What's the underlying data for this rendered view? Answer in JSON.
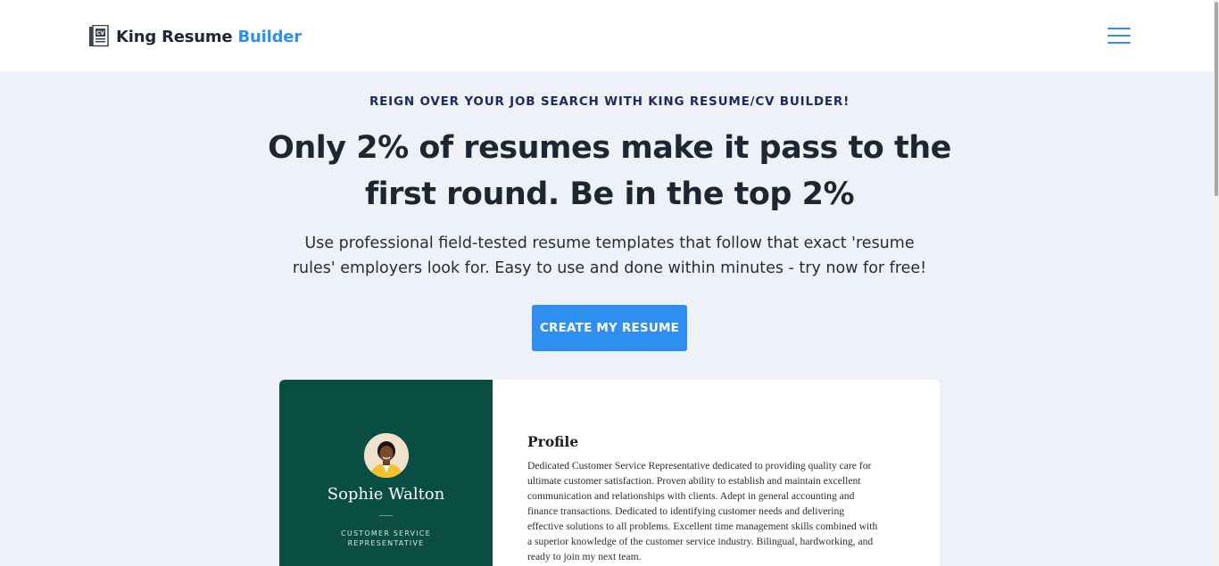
{
  "header": {
    "logo_text": "King Resume",
    "logo_accent": "Builder",
    "logo_icon_label": "CV",
    "menu_icon": "hamburger-menu-icon"
  },
  "hero": {
    "eyebrow": "REIGN OVER YOUR JOB SEARCH WITH KING RESUME/CV BUILDER!",
    "headline_line1": "Only 2% of resumes make it pass to the",
    "headline_line2": "first round. Be in the top 2%",
    "subhead_line1": "Use professional field-tested resume templates that follow that exact 'resume",
    "subhead_line2": "rules' employers look for. Easy to use and done within minutes - try now for free!",
    "cta_label": "CREATE MY RESUME"
  },
  "resume_preview": {
    "name": "Sophie Walton",
    "role_line1": "CUSTOMER SERVICE",
    "role_line2": "REPRESENTATIVE",
    "profile_heading": "Profile",
    "profile_lines": [
      "Dedicated Customer Service Representative dedicated to providing quality care for",
      "ultimate customer satisfaction. Proven ability to establish and maintain excellent",
      "communication and relationships with clients. Adept in general accounting and",
      "finance transactions. Dedicated to identifying customer needs and delivering",
      "effective solutions to all problems. Excellent time management skills combined with",
      "a superior knowledge of the customer service industry. Bilingual, hardworking, and",
      "ready to join my next team."
    ]
  },
  "colors": {
    "accent": "#2e8ff0",
    "page_bg": "#eef1f8",
    "sidebar": "#0a4d43",
    "heading": "#1d2633"
  }
}
